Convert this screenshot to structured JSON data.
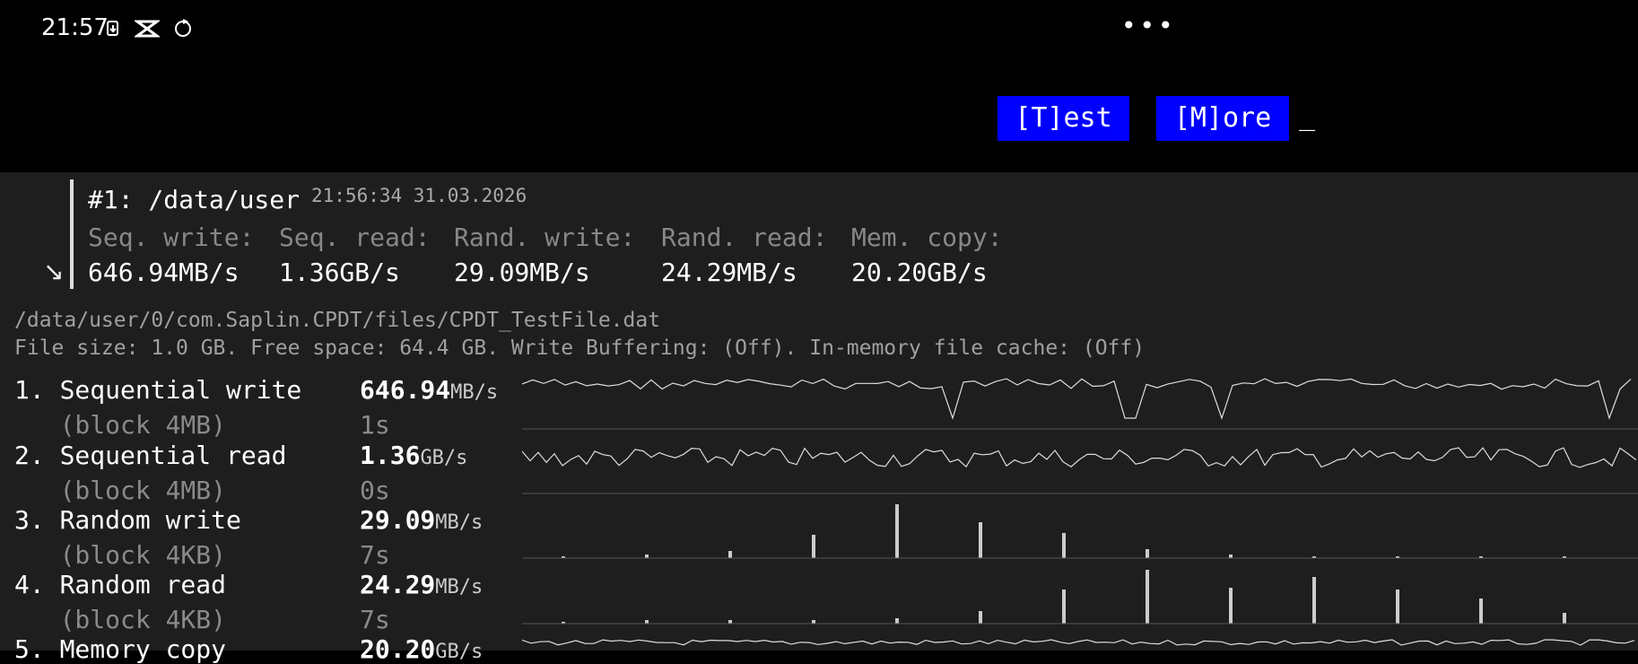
{
  "status_bar": {
    "time": "21:57",
    "icons": [
      "notification-icon",
      "capcut-icon",
      "sync-icon"
    ],
    "more": "•••"
  },
  "toolbar": {
    "test_label": "[T]est",
    "more_label": "[M]ore",
    "cursor": "_",
    "button_color": "#0000ff"
  },
  "history": {
    "title": "#1: /data/user",
    "timestamp": "21:56:34 31.03.2026",
    "arrow": "↘",
    "columns": [
      {
        "label": "Seq. write:",
        "value": "646.94MB/s"
      },
      {
        "label": "Seq. read:",
        "value": "1.36GB/s"
      },
      {
        "label": "Rand. write:",
        "value": "29.09MB/s"
      },
      {
        "label": "Rand. read:",
        "value": "24.29MB/s"
      },
      {
        "label": "Mem. copy:",
        "value": "20.20GB/s"
      }
    ]
  },
  "file": {
    "path": "/data/user/0/com.Saplin.CPDT/files/CPDT_TestFile.dat",
    "info": "File size: 1.0 GB. Free space: 64.4 GB. Write Buffering: (Off). In-memory file cache: (Off)"
  },
  "tests": [
    {
      "name": "1. Sequential write",
      "sub": "   (block 4MB)",
      "value": "646.94",
      "unit": "MB/s",
      "time": "1s"
    },
    {
      "name": "2. Sequential read",
      "sub": "   (block 4MB)",
      "value": "1.36",
      "unit": "GB/s",
      "time": "0s"
    },
    {
      "name": "3. Random write",
      "sub": "   (block 4KB)",
      "value": "29.09",
      "unit": "MB/s",
      "time": "7s"
    },
    {
      "name": "4. Random read",
      "sub": "   (block 4KB)",
      "value": "24.29",
      "unit": "MB/s",
      "time": "7s"
    },
    {
      "name": "5. Memory copy",
      "sub": "",
      "value": "20.20",
      "unit": "GB/s",
      "time": ""
    }
  ]
}
